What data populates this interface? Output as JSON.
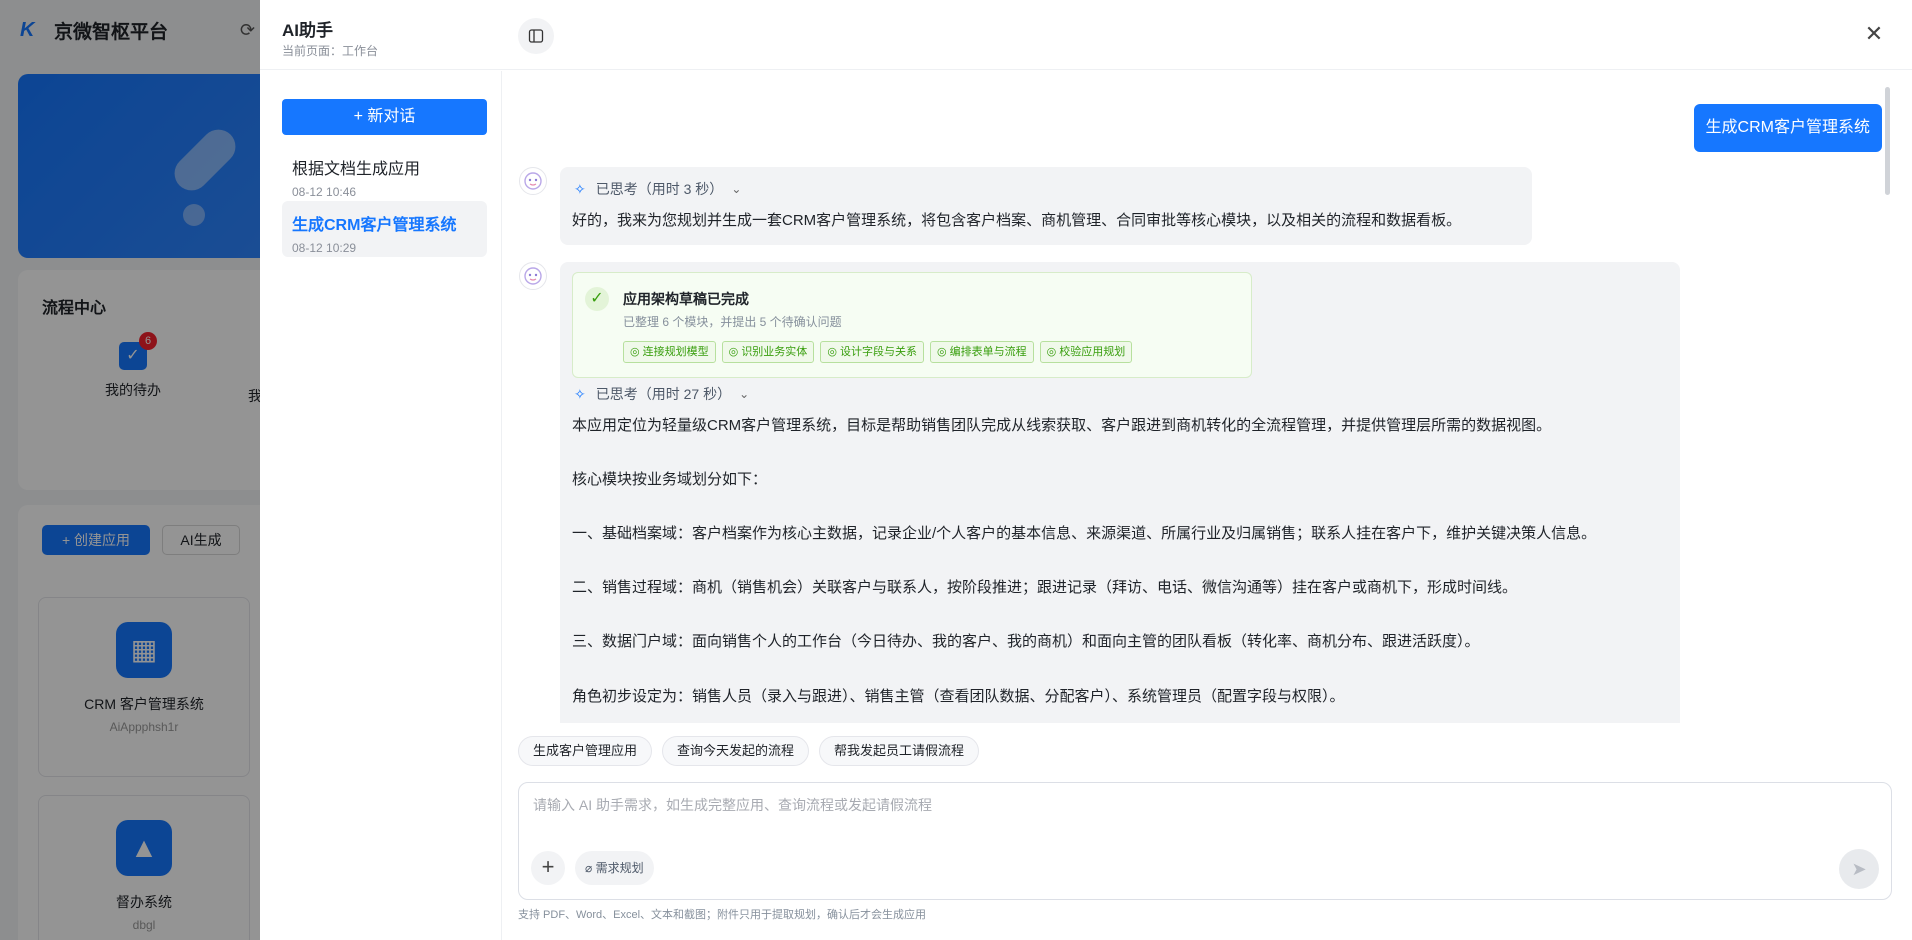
{
  "bg": {
    "platform_title": "京微智枢平台",
    "process_center": "流程中心",
    "todo_label": "我的待办",
    "todo_badge": "6",
    "mine_label_partial": "我",
    "create_app": "+ 创建应用",
    "ai_generate": "AI生成",
    "apps": [
      {
        "name": "CRM 客户管理系统",
        "code": "AiAppphsh1r"
      },
      {
        "name": "督办系统",
        "code": "dbgl"
      }
    ]
  },
  "assistant": {
    "title": "AI助手",
    "subtitle": "当前页面：工作台",
    "new_chat": "+ 新对话",
    "conversations": [
      {
        "title": "根据文档生成应用",
        "date": "08-12 10:46",
        "active": false
      },
      {
        "title": "生成CRM客户管理系统",
        "date": "08-12 10:29",
        "active": true
      }
    ]
  },
  "chat": {
    "user_message": "生成CRM客户管理系统",
    "reply1": {
      "thinking": "已思考（用时 3 秒）",
      "text": "好的，我来为您规划并生成一套CRM客户管理系统，将包含客户档案、商机管理、合同审批等核心模块，以及相关的流程和数据看板。"
    },
    "reply2": {
      "arch_title": "应用架构草稿已完成",
      "arch_sub": "已整理 6 个模块，并提出 5 个待确认问题",
      "steps": [
        "连接规划模型",
        "识别业务实体",
        "设计字段与关系",
        "编排表单与流程",
        "校验应用规划"
      ],
      "thinking": "已思考（用时 27 秒）",
      "paragraphs": [
        "本应用定位为轻量级CRM客户管理系统，目标是帮助销售团队完成从线索获取、客户跟进到商机转化的全流程管理，并提供管理层所需的数据视图。",
        "核心模块按业务域划分如下：",
        "一、基础档案域：客户档案作为核心主数据，记录企业/个人客户的基本信息、来源渠道、所属行业及归属销售；联系人挂在客户下，维护关键决策人信息。",
        "二、销售过程域：商机（销售机会）关联客户与联系人，按阶段推进；跟进记录（拜访、电话、微信沟通等）挂在客户或商机下，形成时间线。",
        "三、数据门户域：面向销售个人的工作台（今日待办、我的客户、我的商机）和面向主管的团队看板（转化率、商机分布、跟进活跃度）。",
        "角色初步设定为：销售人员（录入与跟进）、销售主管（查看团队数据、分配客户）、系统管理员（配置字段与权限）。"
      ]
    }
  },
  "suggestions": [
    "生成客户管理应用",
    "查询今天发起的流程",
    "帮我发起员工请假流程"
  ],
  "input": {
    "placeholder": "请输入 AI 助手需求，如生成完整应用、查询流程或发起请假流程",
    "value": "",
    "requirement_button": "需求规划"
  },
  "footer_note": "支持 PDF、Word、Excel、文本和截图；附件只用于提取规划，确认后才会生成应用",
  "colors": {
    "accent": "#1677ff",
    "success": "#389e0d"
  }
}
